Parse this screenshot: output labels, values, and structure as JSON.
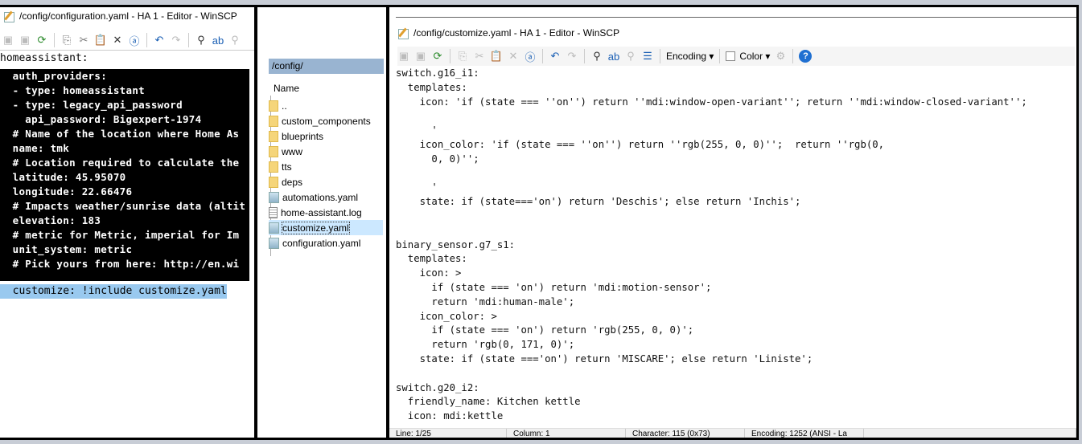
{
  "left_editor": {
    "title": "/config/configuration.yaml - HA 1 - Editor - WinSCP",
    "lines": [
      "homeassistant:",
      "  auth_providers:",
      "  - type: homeassistant",
      "  - type: legacy_api_password",
      "    api_password: Bigexpert-1974",
      "  # Name of the location where Home As",
      "  name: tmk",
      "  # Location required to calculate the",
      "  latitude: 45.95070",
      "  longitude: 22.66476",
      "  # Impacts weather/sunrise data (altit",
      "  elevation: 183",
      "  # metric for Metric, imperial for Im",
      "  unit_system: metric",
      "  # Pick yours from here: http://en.wi"
    ],
    "highlighted_line": "  customize: !include customize.yaml"
  },
  "file_panel": {
    "path": "/config/",
    "column": "Name",
    "items": [
      {
        "name": "..",
        "type": "parent"
      },
      {
        "name": "custom_components",
        "type": "folder"
      },
      {
        "name": "blueprints",
        "type": "folder"
      },
      {
        "name": "www",
        "type": "folder"
      },
      {
        "name": "tts",
        "type": "folder"
      },
      {
        "name": "deps",
        "type": "folder"
      },
      {
        "name": "automations.yaml",
        "type": "yaml"
      },
      {
        "name": "home-assistant.log",
        "type": "log"
      },
      {
        "name": "customize.yaml",
        "type": "yaml",
        "selected": true
      },
      {
        "name": "configuration.yaml",
        "type": "yaml"
      }
    ]
  },
  "right_editor": {
    "title": "/config/customize.yaml - HA 1 - Editor - WinSCP",
    "encoding_label": "Encoding",
    "color_label": "Color",
    "lines": [
      "switch.g16_i1:",
      "  templates:",
      "    icon: 'if (state === ''on'') return ''mdi:window-open-variant''; return ''mdi:window-closed-variant'';",
      "",
      "      '",
      "    icon_color: 'if (state === ''on'') return ''rgb(255, 0, 0)'';  return ''rgb(0,",
      "      0, 0)'';",
      "",
      "      '",
      "    state: if (state==='on') return 'Deschis'; else return 'Inchis';",
      "",
      "",
      "binary_sensor.g7_s1:",
      "  templates:",
      "    icon: >",
      "      if (state === 'on') return 'mdi:motion-sensor';",
      "      return 'mdi:human-male';",
      "    icon_color: >",
      "      if (state === 'on') return 'rgb(255, 0, 0)';",
      "      return 'rgb(0, 171, 0)';",
      "    state: if (state ==='on') return 'MISCARE'; else return 'Liniste';",
      "",
      "switch.g20_i2:",
      "  friendly_name: Kitchen kettle",
      "  icon: mdi:kettle"
    ],
    "status": {
      "line": "Line: 1/25",
      "column": "Column: 1",
      "character": "Character: 115 (0x73)",
      "encoding": "Encoding: 1252  (ANSI - La"
    }
  }
}
